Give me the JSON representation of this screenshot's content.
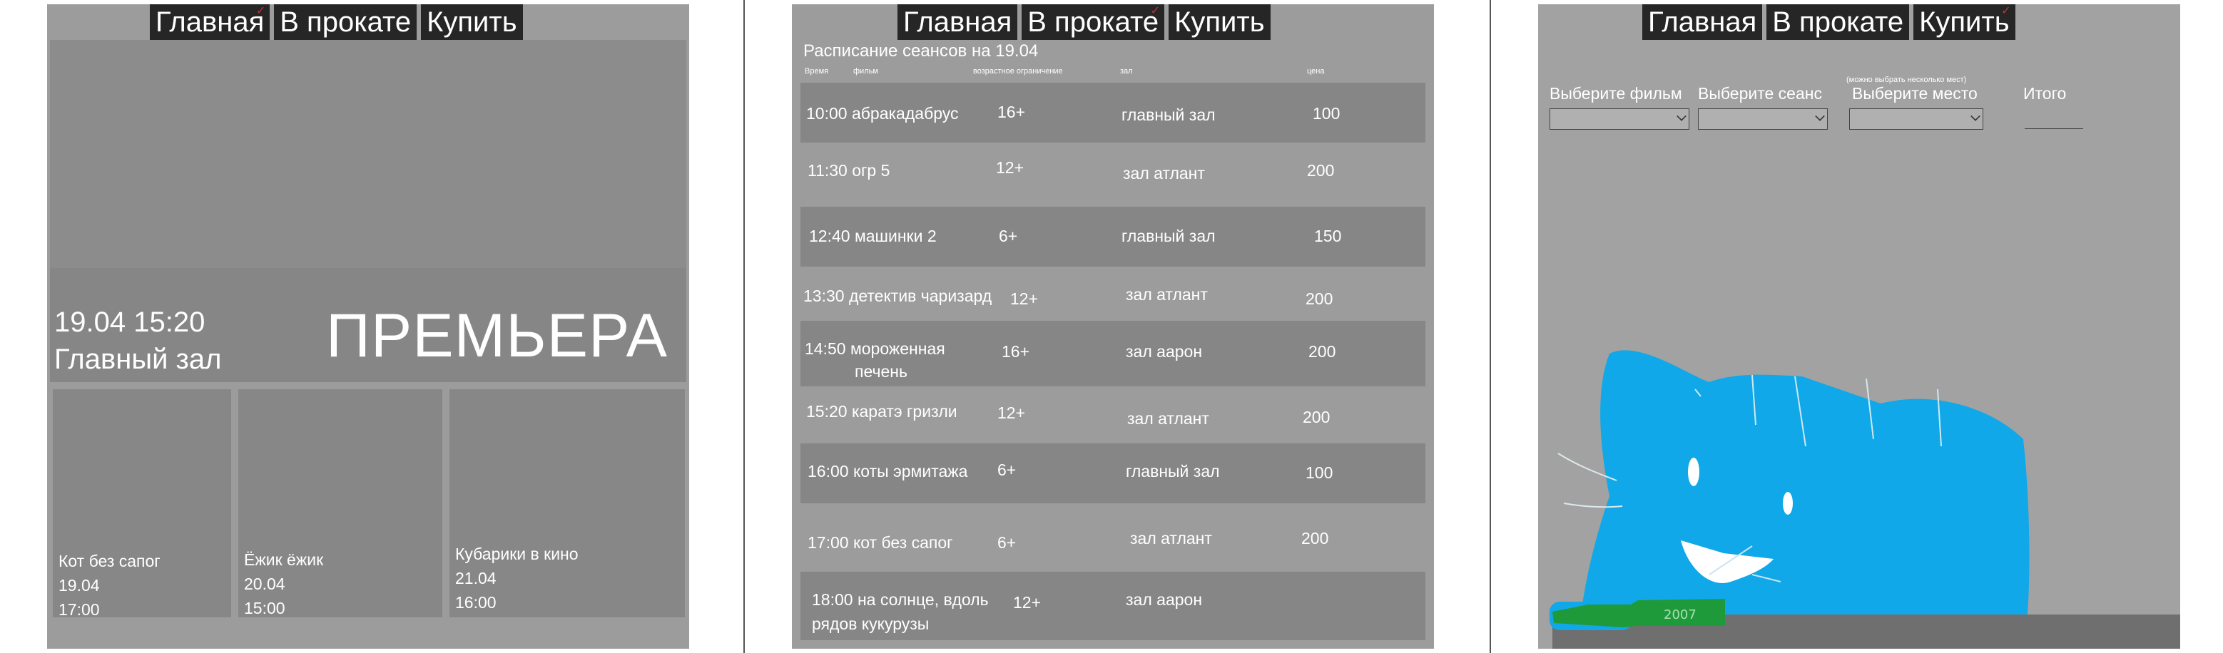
{
  "nav": {
    "home": "Главная",
    "rental": "В прокате",
    "buy": "Купить"
  },
  "home": {
    "premiere": {
      "datetime": "19.04 15:20",
      "hall": "Главный зал",
      "label": "ПРЕМЬЕРА"
    },
    "cards": [
      {
        "title": "Кот без сапог",
        "date": "19.04",
        "time": "17:00"
      },
      {
        "title": "Ёжик ёжик",
        "date": "20.04",
        "time": "15:00"
      },
      {
        "title": "Кубарики в кино",
        "date": "21.04",
        "time": "16:00"
      }
    ]
  },
  "schedule": {
    "title": "Расписание сеансов на 19.04",
    "headers": {
      "time": "Время",
      "film": "фильм",
      "age": "возрастное ограничение",
      "hall": "зал",
      "price": "цена"
    },
    "rows": [
      {
        "time_film": "10:00 абракадабрус",
        "age": "16+",
        "hall": "главный зал",
        "price": "100"
      },
      {
        "time_film": "11:30 огр 5",
        "age": "12+",
        "hall": "зал атлант",
        "price": "200"
      },
      {
        "time_film": "12:40 машинки 2",
        "age": "6+",
        "hall": "главный зал",
        "price": "150"
      },
      {
        "time_film": "13:30 детектив чаризард",
        "age": "12+",
        "hall": "зал атлант",
        "price": "200"
      },
      {
        "time_film": "14:50 мороженная",
        "time_film_2": "печень",
        "age": "16+",
        "hall": "зал аарон",
        "price": "200"
      },
      {
        "time_film": "15:20 каратэ гризли",
        "age": "12+",
        "hall": "зал атлант",
        "price": "200"
      },
      {
        "time_film": "16:00 коты эрмитажа",
        "age": "6+",
        "hall": "главный зал",
        "price": "100"
      },
      {
        "time_film": "17:00 кот без сапог",
        "age": "6+",
        "hall": "зал атлант",
        "price": "200"
      },
      {
        "time_film": "18:00 на солнце, вдоль",
        "time_film_2": "рядов кукурузы",
        "age": "12+",
        "hall": "зал аарон",
        "price": ""
      }
    ]
  },
  "buy": {
    "film_label": "Выберите фильм",
    "session_label": "Выберите сеанс",
    "seat_label": "Выберите место",
    "seat_note": "(можно выбрать несколько мест)",
    "total_label": "Итого",
    "bottle_text": "2007"
  },
  "colors": {
    "mascot": "#10a8e8",
    "bottle": "#1f9a3a",
    "nav_bg": "#262626"
  }
}
